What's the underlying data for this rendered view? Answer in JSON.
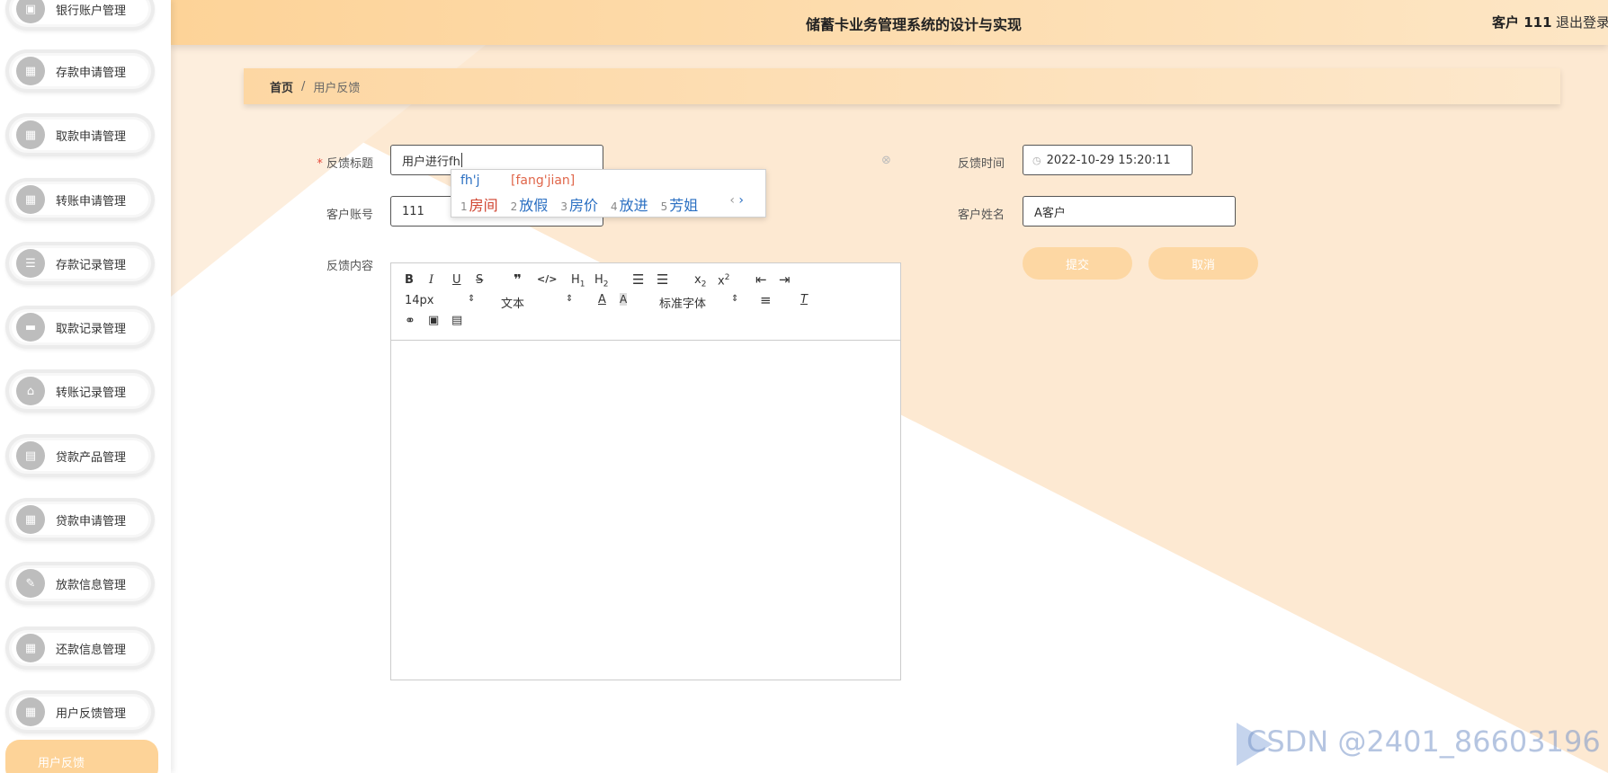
{
  "header": {
    "title": "储蓄卡业务管理系统的设计与实现",
    "user": "客户 111",
    "logout": "退出登录"
  },
  "sidebar": {
    "items": [
      {
        "label": "银行账户管理",
        "icon": "briefcase-icon"
      },
      {
        "label": "存款申请管理",
        "icon": "grid-icon"
      },
      {
        "label": "取款申请管理",
        "icon": "grid-icon"
      },
      {
        "label": "转账申请管理",
        "icon": "grid-icon"
      },
      {
        "label": "存款记录管理",
        "icon": "list-icon"
      },
      {
        "label": "取款记录管理",
        "icon": "ticket-icon"
      },
      {
        "label": "转账记录管理",
        "icon": "home-share-icon"
      },
      {
        "label": "贷款产品管理",
        "icon": "chart-icon"
      },
      {
        "label": "贷款申请管理",
        "icon": "grid-icon"
      },
      {
        "label": "放款信息管理",
        "icon": "clipboard-icon"
      },
      {
        "label": "还款信息管理",
        "icon": "grid-icon"
      },
      {
        "label": "用户反馈管理",
        "icon": "grid-icon"
      }
    ],
    "active": "用户反馈"
  },
  "breadcrumb": {
    "home": "首页",
    "separator": "/",
    "current": "用户反馈"
  },
  "form": {
    "title_label": "反馈标题",
    "title_required": "*",
    "title_value": "用户进行fh",
    "account_label": "客户账号",
    "account_value": "111",
    "content_label": "反馈内容",
    "time_label": "反馈时间",
    "time_value": "2022-10-29 15:20:11",
    "name_label": "客户姓名",
    "name_value": "A客户",
    "submit": "提交",
    "cancel": "取消"
  },
  "editor": {
    "font_size": "14px",
    "block_type": "文本",
    "font_family": "标准字体"
  },
  "ime": {
    "composition": "fh'j",
    "pinyin": "[fang'jian]",
    "candidates": [
      {
        "n": "1",
        "text": "房间"
      },
      {
        "n": "2",
        "text": "放假"
      },
      {
        "n": "3",
        "text": "房价"
      },
      {
        "n": "4",
        "text": "放进"
      },
      {
        "n": "5",
        "text": "芳姐"
      }
    ]
  },
  "watermark": "CSDN @2401_86603196",
  "colors": {
    "accent": "#fdd398",
    "accent_light": "#fde8cc",
    "bg_triangle": "#fdebd6"
  }
}
